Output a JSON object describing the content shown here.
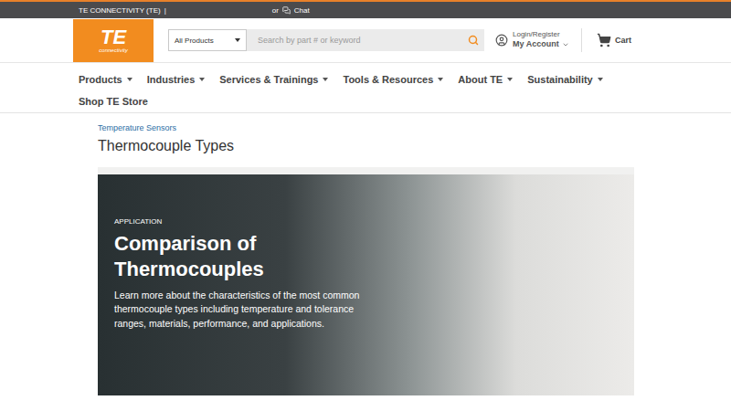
{
  "topbar": {
    "company": "TE CONNECTIVITY (TE)",
    "separator": "|",
    "or": "or",
    "chat": "Chat"
  },
  "logo": {
    "mark": "TE",
    "tagline": "connectivity"
  },
  "search": {
    "scope": "All Products",
    "placeholder": "Search by part # or keyword"
  },
  "account": {
    "login": "Login/Register",
    "label": "My Account"
  },
  "cart": {
    "label": "Cart"
  },
  "nav": [
    {
      "label": "Products"
    },
    {
      "label": "Industries"
    },
    {
      "label": "Services & Trainings"
    },
    {
      "label": "Tools & Resources"
    },
    {
      "label": "About TE"
    },
    {
      "label": "Sustainability"
    }
  ],
  "shop": {
    "label": "Shop TE Store"
  },
  "breadcrumb": {
    "label": "Temperature Sensors"
  },
  "page_title": "Thermocouple Types",
  "hero": {
    "eyebrow": "APPLICATION",
    "title": "Comparison of Thermocouples",
    "description": "Learn more about the characteristics of the most common thermocouple types including temperature and tolerance ranges, materials, performance, and applications."
  }
}
